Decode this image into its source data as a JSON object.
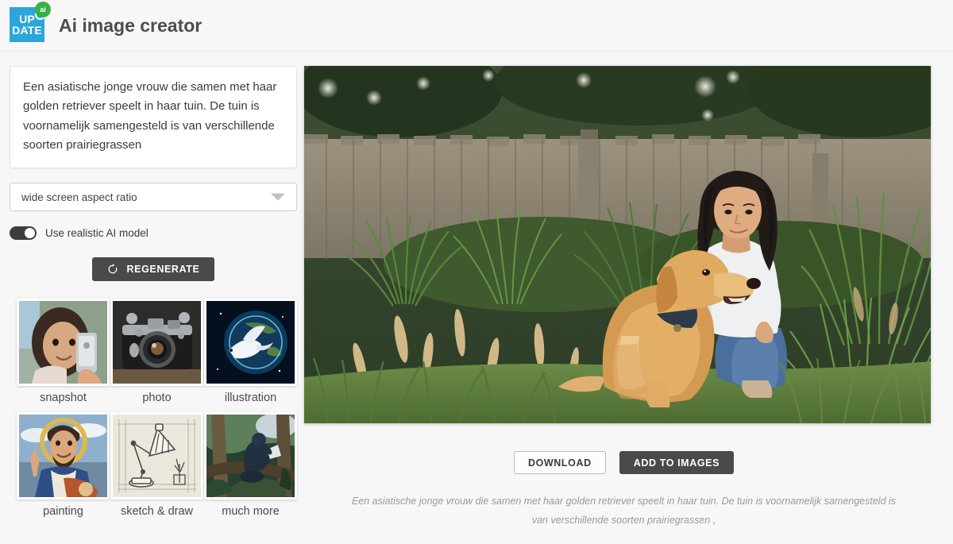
{
  "header": {
    "logo": {
      "line1": "UP",
      "line2": "DATE",
      "badge": "ai",
      "clock_icon": "clock-icon"
    },
    "title": "Ai image creator"
  },
  "sidebar": {
    "prompt": {
      "text": "Een asiatische jonge vrouw die samen met haar golden retriever speelt in haar tuin. De tuin is voornamelijk samengesteld is van verschillende soorten prairiegrassen"
    },
    "aspect_select": {
      "value": "wide screen aspect ratio",
      "caret_icon": "chevron-down-icon"
    },
    "realistic_toggle": {
      "label": "Use realistic AI model",
      "state": "on"
    },
    "regenerate_button": {
      "label": "REGENERATE",
      "icon": "refresh-icon"
    },
    "styles": [
      {
        "label": "snapshot",
        "art": "girl-with-phone"
      },
      {
        "label": "photo",
        "art": "vintage-camera"
      },
      {
        "label": "illustration",
        "art": "dove-and-earth"
      },
      {
        "label": "painting",
        "art": "saint-portrait"
      },
      {
        "label": "sketch & draw",
        "art": "desk-lamp-sketch"
      },
      {
        "label": "much more",
        "art": "ape-reading-in-tree"
      }
    ]
  },
  "main": {
    "generated_image": {
      "alt": "Asian young woman kneeling in a garden petting a golden retriever, wooden fence and ornamental prairie grasses"
    },
    "download_button": {
      "label": "DOWNLOAD"
    },
    "add_to_images_button": {
      "label": "ADD TO IMAGES"
    },
    "caption": "Een asiatische jonge vrouw die samen met haar golden retriever speelt in haar tuin. De tuin is voornamelijk samengesteld is van verschillende soorten prairiegrassen ,"
  },
  "colors": {
    "brand_blue": "#2ba6db",
    "badge_green": "#35b14a",
    "dark_button": "#4a4a4a",
    "page_bg": "#f7f7f7"
  }
}
